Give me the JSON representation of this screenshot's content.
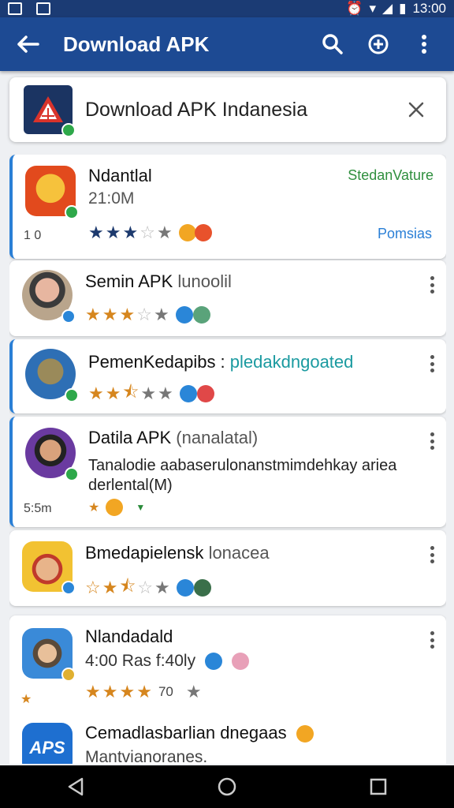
{
  "status_bar": {
    "time": "13:00"
  },
  "app_bar": {
    "title": "Download APK"
  },
  "search": {
    "query": "Download APK Indanesia"
  },
  "items": [
    {
      "name": "Ndantlal",
      "size": "21:0M",
      "side": "1 0",
      "top_right": "StedanVature",
      "action": "Pomsias",
      "rating_stars": 3
    },
    {
      "name": "Semin APK",
      "tag": "lunoolil",
      "rating_stars": 3
    },
    {
      "name": "PemenKedapibs :",
      "link": "pledakdngoated",
      "rating_stars": 2.5
    },
    {
      "name": "Datila APK",
      "tag": "(nanalatal)",
      "desc": "Tanalodie aabaserulonanstmimdehkay ariea derlental(M)",
      "side": "5:5m"
    },
    {
      "name": "Bmedapielensk",
      "tag": "lonacea",
      "rating_stars": 2.5
    },
    {
      "name": "Nlandadald",
      "sub": "4:00 Ras f:40ly",
      "rating_value": "70",
      "rating_stars": 4
    },
    {
      "name": "Cemadlasbarlian dnegaas",
      "sub": "Mantvianoranes."
    }
  ],
  "colors": {
    "app_bar": "#1d4a93",
    "accent": "#2a7fd6",
    "star_gold": "#d6861e",
    "star_navy": "#1d3a6e"
  }
}
